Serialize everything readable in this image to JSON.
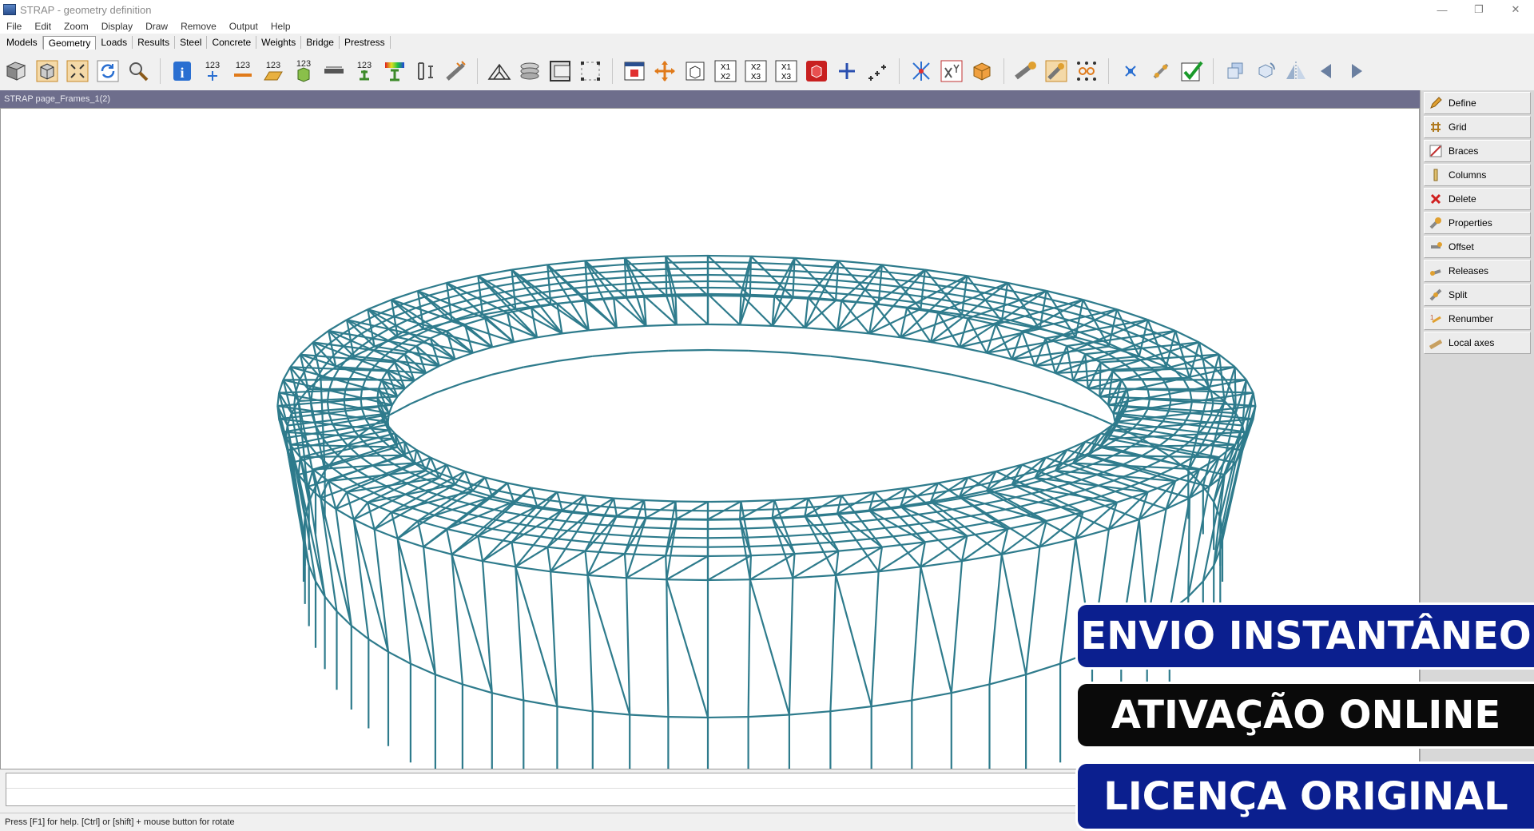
{
  "window": {
    "title": "STRAP - geometry definition",
    "controls": [
      "—",
      "❐",
      "✕"
    ]
  },
  "menu": [
    "File",
    "Edit",
    "Zoom",
    "Display",
    "Draw",
    "Remove",
    "Output",
    "Help"
  ],
  "tabs": {
    "items": [
      "Models",
      "Geometry",
      "Loads",
      "Results",
      "Steel",
      "Concrete",
      "Weights",
      "Bridge",
      "Prestress"
    ],
    "active": "Geometry"
  },
  "toolbar": {
    "number_labels": [
      "123",
      "123",
      "123",
      "123",
      "123"
    ],
    "coord_labels": [
      [
        "X1",
        "X2"
      ],
      [
        "X2",
        "X3"
      ],
      [
        "X1",
        "X3"
      ]
    ],
    "icons": [
      "model-3d-icon",
      "cube-icon",
      "zoom-fit-icon",
      "refresh-icon",
      "search-icon",
      "info-icon",
      "node-numbers-icon",
      "member-numbers-icon",
      "element-numbers-icon",
      "solid-numbers-icon",
      "section-icon",
      "support-numbers-icon",
      "color-properties-icon",
      "beam-section-icon",
      "local-axes-icon",
      "truss-icon",
      "spring-icon",
      "frame-icon",
      "select-nodes-icon",
      "window-icon",
      "move-icon",
      "box-view-icon",
      "x1x2-icon",
      "x2x3-icon",
      "x1x3-icon",
      "render-cube-icon",
      "add-node-icon",
      "add-nodes-icon",
      "star-nodes-icon",
      "xy-icon",
      "orange-cube-icon",
      "offset-icon",
      "release-icon",
      "dots-grid-icon",
      "scale-icon",
      "link-icon",
      "check-icon",
      "copy-icon",
      "rotate-view-icon",
      "mirror-icon",
      "prev-arrow-icon",
      "next-arrow-icon"
    ]
  },
  "view": {
    "title": "STRAP page_Frames_1(2)",
    "structure_color": "#2e7b8c"
  },
  "side_panel": {
    "buttons": [
      {
        "label": "Define",
        "icon": "pencil-icon"
      },
      {
        "label": "Grid",
        "icon": "grid-icon"
      },
      {
        "label": "Braces",
        "icon": "braces-icon"
      },
      {
        "label": "Columns",
        "icon": "columns-icon"
      },
      {
        "label": "Delete",
        "icon": "delete-icon"
      },
      {
        "label": "Properties",
        "icon": "properties-icon"
      },
      {
        "label": "Offset",
        "icon": "offset-icon"
      },
      {
        "label": "Releases",
        "icon": "releases-icon"
      },
      {
        "label": "Split",
        "icon": "split-icon"
      },
      {
        "label": "Renumber",
        "icon": "renumber-icon"
      },
      {
        "label": "Local axes",
        "icon": "local-axes-icon"
      }
    ]
  },
  "status": {
    "text": "Press [F1] for help. [Ctrl] or [shift] + mouse button for rotate"
  },
  "banners": {
    "b1": "ENVIO INSTANTÂNEO",
    "b2": "ATIVAÇÃO ONLINE",
    "b3": "LICENÇA ORIGINAL"
  },
  "colors": {
    "banner_blue": "#0b1f8f",
    "banner_black": "#0a0a0a",
    "view_header": "#6e6e8c"
  }
}
